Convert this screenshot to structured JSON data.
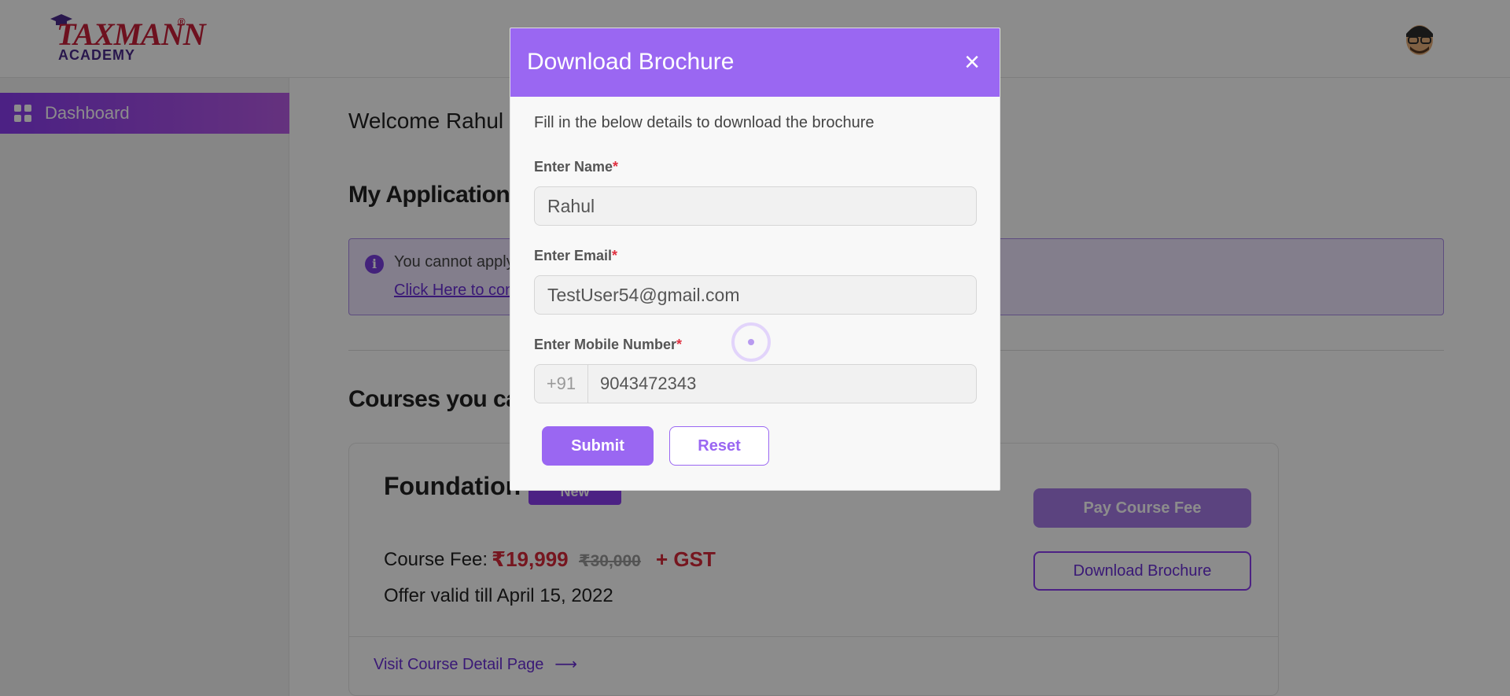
{
  "header": {
    "logo_brand": "TAXMANN",
    "logo_registered": "®",
    "logo_sub": "ACADEMY",
    "avatar_icon": "user-avatar-icon"
  },
  "sidebar": {
    "items": [
      {
        "label": "Dashboard",
        "icon": "dashboard-grid-icon"
      }
    ]
  },
  "main": {
    "welcome": "Welcome Rahul",
    "my_applications_heading": "My Applications",
    "notice": {
      "icon": "info-icon",
      "message": "You cannot apply",
      "link": "Click Here to con"
    },
    "courses_heading": "Courses you can",
    "course": {
      "title": "Foundation",
      "badge": "New",
      "fee_label": "Course Fee:",
      "fee_price": "₹19,999",
      "fee_old_price": "₹30,000",
      "fee_tax": "+ GST",
      "offer": "Offer valid till April 15, 2022",
      "pay_button": "Pay Course Fee",
      "download_button": "Download Brochure",
      "visit_link": "Visit Course Detail Page",
      "visit_arrow": "⟶"
    }
  },
  "modal": {
    "title": "Download Brochure",
    "close_icon": "×",
    "intro": "Fill in the below details to download the brochure",
    "name_label": "Enter Name",
    "name_value": "Rahul",
    "email_label": "Enter Email",
    "email_value": "TestUser54@gmail.com",
    "mobile_label": "Enter Mobile Number",
    "mobile_country_code": "+91",
    "mobile_value": "9043472343",
    "required_marker": "*",
    "submit_label": "Submit",
    "reset_label": "Reset"
  },
  "colors": {
    "accent": "#9a67f2",
    "sidebar_active_start": "#8a3cf0",
    "sidebar_active_end": "#b85be6",
    "price_red": "#d8283a",
    "brand_red": "#c8203a"
  }
}
